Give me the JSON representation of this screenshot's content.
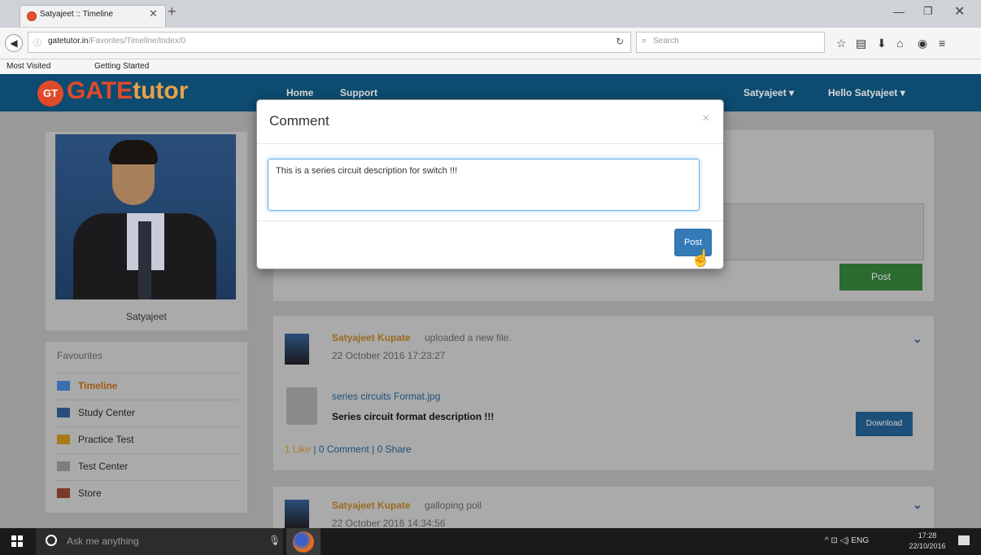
{
  "browser": {
    "tab_title": "Satyajeet :: Timeline",
    "tab_close": "✕",
    "new_tab": "+",
    "url_host": "gatetutor.in",
    "url_path": "/Favorites/Timeline/Index/0",
    "search_placeholder": "Search",
    "bookmarks": [
      "Most Visited",
      "Getting Started"
    ]
  },
  "site": {
    "logo_gt": "GT",
    "logo_gate": "GATE",
    "logo_tutor": "tutor",
    "nav": [
      "Home",
      "Support"
    ],
    "user_menu": "Satyajeet ▾",
    "hello_menu": "Hello Satyajeet ▾"
  },
  "profile": {
    "name": "Satyajeet"
  },
  "favourites": {
    "title": "Favourites",
    "items": [
      "Timeline",
      "Study Center",
      "Practice Test",
      "Test Center",
      "Store"
    ]
  },
  "composer": {
    "post_label": "Post"
  },
  "feed": [
    {
      "author": "Satyajeet Kupate",
      "action": "uploaded a new file.",
      "time": "22 October 2016 17:23:27",
      "file_name": "series circuits Format.jpg",
      "description": "Series circuit format description !!!",
      "download_label": "Download",
      "likes": "1 Like",
      "comments": "| 0 Comment | 0 Share"
    },
    {
      "author": "Satyajeet Kupate",
      "action": "galloping poll",
      "time": "22 October 2016 14:34:56"
    }
  ],
  "modal": {
    "title": "Comment",
    "close": "×",
    "comment_text": "This is a series circuit description for switch !!!",
    "post_label": "Post"
  },
  "taskbar": {
    "search_placeholder": "Ask me anything",
    "tray": "^  ⊡  ◁)  ENG",
    "time": "17:28",
    "date": "22/10/2016"
  }
}
